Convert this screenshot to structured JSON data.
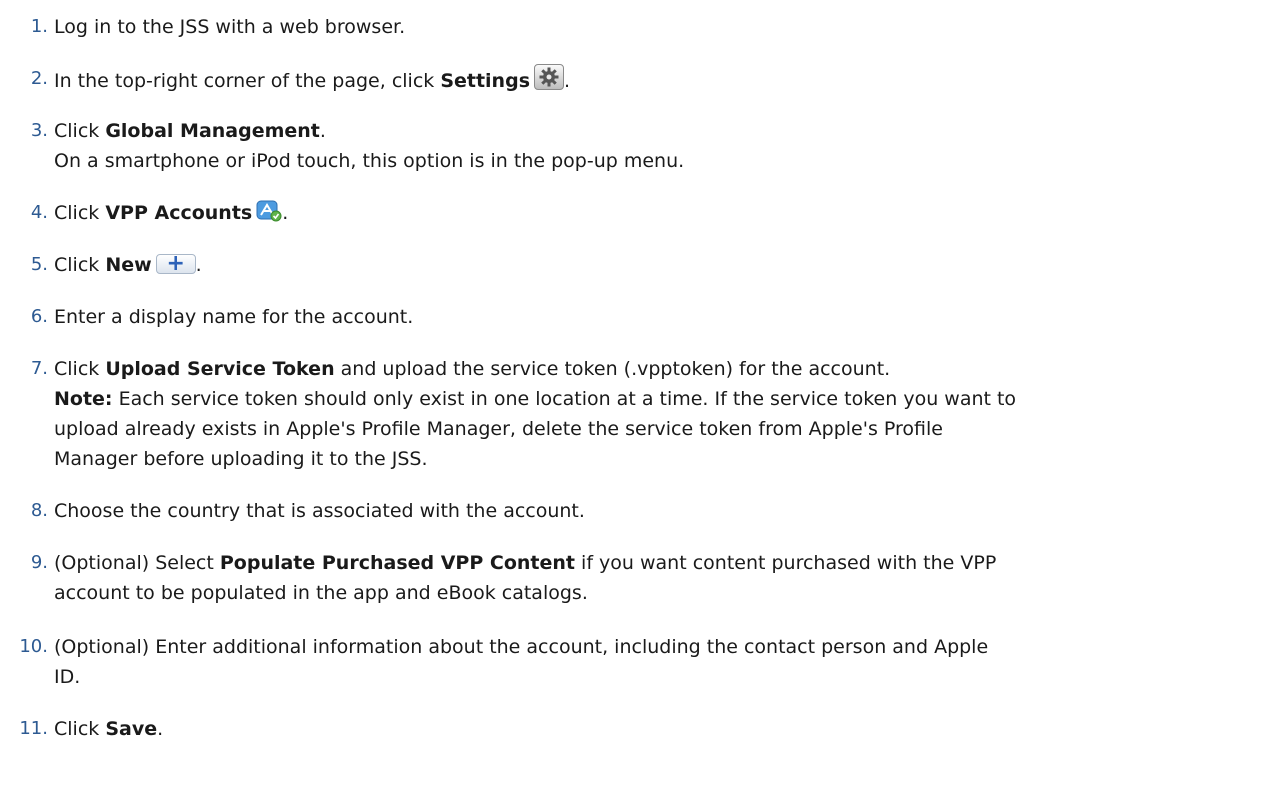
{
  "steps": [
    {
      "num": "1.",
      "text": "Log in to the JSS with a web browser."
    },
    {
      "num": "2.",
      "pre": "In the top-right corner of the page, click ",
      "bold": "Settings",
      "post": "."
    },
    {
      "num": "3.",
      "pre": "Click ",
      "bold": "Global Management",
      "post": ".",
      "line2": "On a smartphone or iPod touch, this option is in the pop-up menu."
    },
    {
      "num": "4.",
      "pre": "Click ",
      "bold": "VPP Accounts",
      "post": "."
    },
    {
      "num": "5.",
      "pre": "Click ",
      "bold": "New",
      "post": "."
    },
    {
      "num": "6.",
      "text": "Enter a display name for the account."
    },
    {
      "num": "7.",
      "pre": "Click ",
      "bold": "Upload Service Token",
      "post": " and upload the service token (.vpptoken) for the account.",
      "note_label": "Note:",
      "note_l1": " Each service token should only exist in one location at a time. If the service token you want to",
      "note_l2": "upload already exists in Apple's Profile Manager, delete the service token from Apple's Profile",
      "note_l3": "Manager before uploading it to the JSS."
    },
    {
      "num": "8.",
      "text": "Choose the country that is associated with the account."
    },
    {
      "num": "9.",
      "pre": "(Optional) Select ",
      "bold": "Populate Purchased VPP Content",
      "post": " if you want content purchased with the VPP",
      "line2": "account to be populated in the app and eBook catalogs."
    },
    {
      "num": "10.",
      "text": "(Optional) Enter additional information about the account, including the contact person and Apple",
      "line2": "ID."
    },
    {
      "num": "11.",
      "pre": "Click ",
      "bold": "Save",
      "post": "."
    }
  ],
  "icons": {
    "settings": "gear-icon",
    "vpp": "app-store-check-icon",
    "new": "plus-icon",
    "new_symbol": "+"
  }
}
